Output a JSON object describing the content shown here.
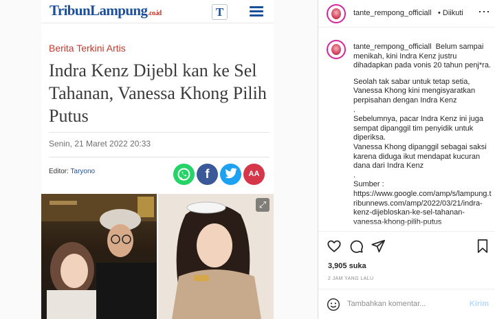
{
  "article": {
    "site_logo": "TribunLampung",
    "site_logo_suffix": ".co.id",
    "t_logo": "T",
    "kicker": "Berita Terkini Artis",
    "headline": "Indra Kenz Dijebl  kan ke Sel Tahanan, Vanessa Khong Pilih Putus",
    "date": "Senin, 21 Maret 2022 20:33",
    "editor_label": "Editor:",
    "editor_name": "Taryono",
    "share": [
      {
        "name": "whatsapp",
        "label": "✆",
        "color": "#25d366"
      },
      {
        "name": "facebook",
        "label": "f",
        "color": "#3b5998"
      },
      {
        "name": "twitter",
        "label": "🐦",
        "color": "#1da1f2"
      },
      {
        "name": "font-size",
        "label": "AA",
        "color": "#d5364a"
      }
    ]
  },
  "post": {
    "username": "tante_rempong_officiall",
    "follow_dot": "•",
    "follow_label": "Diikuti",
    "caption_username": "tante_rempong_officiall",
    "caption_lines": [
      "Belum sampai menikah, kini Indra Kenz justru dihadapkan pada vonis 20 tahun penj*ra.",
      "",
      "Seolah tak sabar untuk tetap setia, Vanessa Khong kini mengisyaratkan perpisahan dengan Indra Kenz",
      ".",
      "Sebelumnya, pacar Indra Kenz ini juga sempat dipanggil tim penyidik untuk diperiksa.",
      "Vanessa Khong dipanggil sebagai saksi karena diduga ikut mendapat kucuran dana dari Indra Kenz",
      ".",
      "Sumber :",
      "https://www.google.com/amp/s/lampung.tribunnews.com/amp/2022/03/21/indra-kenz-dijebloskan-ke-sel-tahanan-vanessa-khong-pilih-putus"
    ],
    "likes": "3,905 suka",
    "time_ago": "2 JAM YANG LALU",
    "comment_placeholder": "Tambahkan komentar...",
    "send_label": "Kirim"
  },
  "colors": {
    "tribun_blue": "#1b4f9c",
    "kicker_red": "#c0392b",
    "send_disabled": "#b3dbff"
  }
}
